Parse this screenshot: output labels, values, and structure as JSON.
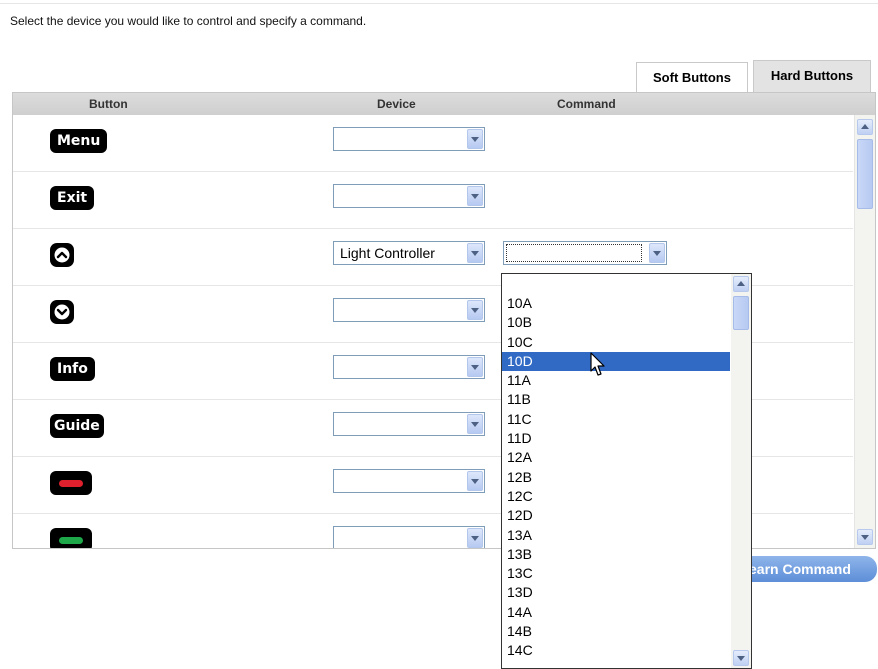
{
  "instruction": "Select the device you would like to control and specify a command.",
  "tabs": [
    {
      "label": "Soft Buttons",
      "active": false
    },
    {
      "label": "Hard Buttons",
      "active": true
    }
  ],
  "table": {
    "headers": {
      "button": "Button",
      "device": "Device",
      "command": "Command"
    },
    "rows": [
      {
        "button": "Menu",
        "device": ""
      },
      {
        "button": "Exit",
        "device": ""
      },
      {
        "button": "up-arrow-icon",
        "device": "Light Controller",
        "command": ""
      },
      {
        "button": "down-arrow-icon",
        "device": ""
      },
      {
        "button": "Info",
        "device": ""
      },
      {
        "button": "Guide",
        "device": ""
      },
      {
        "button": "red-bar-icon",
        "device": ""
      },
      {
        "button": "green-bar-icon",
        "device": ""
      }
    ]
  },
  "command_dropdown": {
    "options": [
      "10A",
      "10B",
      "10C",
      "10D",
      "11A",
      "11B",
      "11C",
      "11D",
      "12A",
      "12B",
      "12C",
      "12D",
      "13A",
      "13B",
      "13C",
      "13D",
      "14A",
      "14B",
      "14C"
    ],
    "selected": "10D"
  },
  "learn_button": "earn Command",
  "colors": {
    "selection": "#316ac5",
    "header_bg": "#d5d5d5",
    "button_black": "#000000",
    "red_bar": "#e0202c",
    "green_bar": "#1ea84a",
    "learn_button": "#6f9de0"
  }
}
